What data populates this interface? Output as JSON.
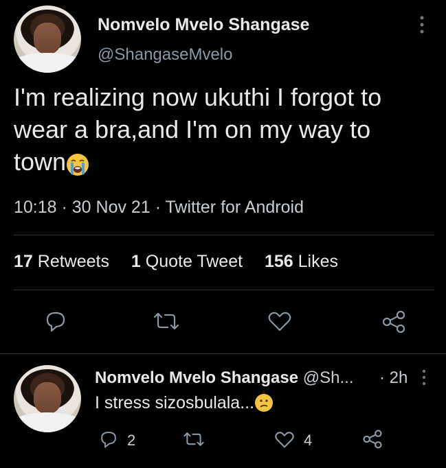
{
  "main_tweet": {
    "author_name": "Nomvelo Mvelo Shangase",
    "handle": "@ShangaseMvelo",
    "text_line1": "I'm realizing now ukuthi I forgot to",
    "text_line2": "wear a bra,and I'm on my way to",
    "text_line3": "town",
    "emoji": "😭",
    "timestamp": "10:18 · 30 Nov 21 · Twitter for Android",
    "stats": {
      "retweets_count": "17",
      "retweets_label": "Retweets",
      "quotes_count": "1",
      "quotes_label": "Quote Tweet",
      "likes_count": "156",
      "likes_label": "Likes"
    }
  },
  "reply": {
    "author_name": "Nomvelo Mvelo Shangase",
    "handle": "@Sh...",
    "time": "· 2h",
    "text": "I stress sizosbulala...",
    "emoji": "😕",
    "reply_count": "2",
    "like_count": "4"
  },
  "colors": {
    "background": "#000000",
    "text": "#e7e9ea",
    "muted": "#8b98a5",
    "divider": "#2f3336"
  },
  "icons": [
    "kebab-menu-icon",
    "reply-icon",
    "retweet-icon",
    "like-icon",
    "share-icon"
  ]
}
